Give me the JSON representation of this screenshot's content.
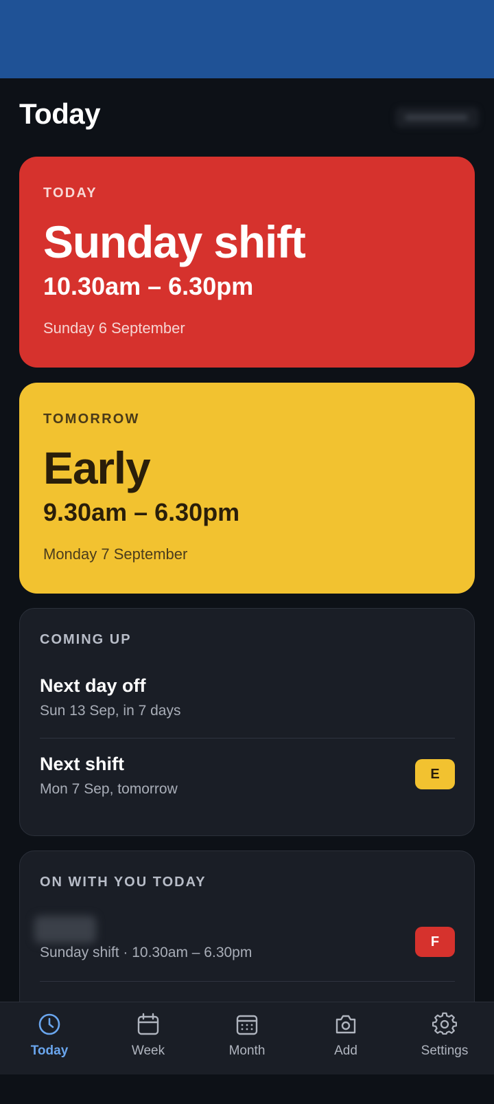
{
  "header": {
    "title": "Today"
  },
  "today_card": {
    "eyebrow": "TODAY",
    "title": "Sunday shift",
    "time": "10.30am – 6.30pm",
    "date": "Sunday 6 September",
    "color": "#d6322d"
  },
  "tomorrow_card": {
    "eyebrow": "TOMORROW",
    "title": "Early",
    "time": "9.30am – 6.30pm",
    "date": "Monday 7 September",
    "color": "#f2c230"
  },
  "coming_up": {
    "heading": "COMING UP",
    "items": [
      {
        "title": "Next day off",
        "subtitle": "Sun 13 Sep, in 7 days"
      },
      {
        "title": "Next shift",
        "subtitle": "Mon 7 Sep, tomorrow",
        "badge": "E",
        "badge_color": "#f2c230"
      }
    ]
  },
  "on_with_you": {
    "heading": "ON WITH YOU TODAY",
    "items": [
      {
        "subtitle": "Sunday shift · 10.30am – 6.30pm",
        "badge": "F",
        "badge_color": "#d6322d"
      }
    ]
  },
  "bottom_nav": {
    "active": "Today",
    "accent": "#6aa6ee",
    "items": [
      {
        "label": "Today",
        "icon": "clock-icon"
      },
      {
        "label": "Week",
        "icon": "calendar-week-icon"
      },
      {
        "label": "Month",
        "icon": "calendar-month-icon"
      },
      {
        "label": "Add",
        "icon": "camera-icon"
      },
      {
        "label": "Settings",
        "icon": "gear-icon"
      }
    ]
  }
}
